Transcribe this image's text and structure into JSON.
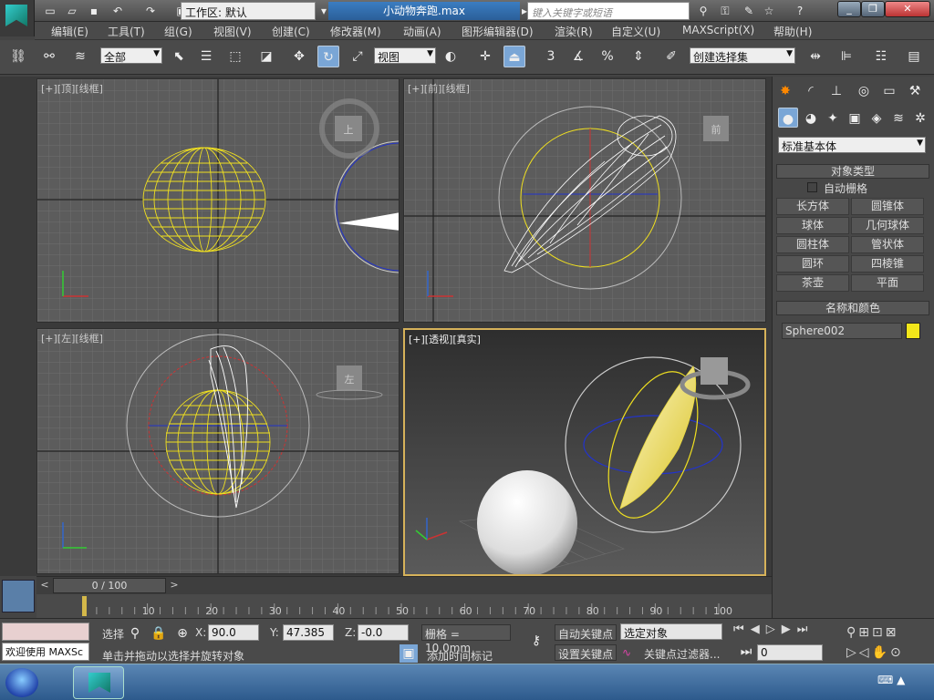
{
  "titlebar": {
    "workspace_label": "工作区: 默认",
    "doc_title": "小动物奔跑.max",
    "search_placeholder": "键入关键字或短语"
  },
  "menu": [
    "编辑(E)",
    "工具(T)",
    "组(G)",
    "视图(V)",
    "创建(C)",
    "修改器(M)",
    "动画(A)",
    "图形编辑器(D)",
    "渲染(R)",
    "自定义(U)",
    "MAXScript(X)",
    "帮助(H)"
  ],
  "toolbar": {
    "selection_filter": "全部",
    "ref_coord": "视图",
    "named_selection": "创建选择集",
    "snap_3": "3",
    "snap_pct": "%"
  },
  "viewports": {
    "top_label": "[+][顶][线框]",
    "front_label": "[+][前][线框]",
    "left_label": "[+][左][线框]",
    "persp_label": "[+][透视][真实]",
    "top_cube": "上",
    "front_cube": "前",
    "left_cube": "左"
  },
  "command_panel": {
    "category": "标准基本体",
    "object_type_title": "对象类型",
    "autogrid_label": "自动栅格",
    "buttons": [
      "长方体",
      "圆锥体",
      "球体",
      "几何球体",
      "圆柱体",
      "管状体",
      "圆环",
      "四棱锥",
      "茶壶",
      "平面"
    ],
    "name_color_title": "名称和颜色",
    "object_name": "Sphere002",
    "object_color": "#f2e61a"
  },
  "timeline": {
    "frame_readout": "0 / 100",
    "ticks": [
      "10",
      "20",
      "30",
      "40",
      "50",
      "60",
      "70",
      "80",
      "90",
      "100"
    ]
  },
  "status": {
    "maxscript_welcome": "欢迎使用 MAXSc",
    "selected_label": "选择",
    "x_label": "X:",
    "x_value": "90.0",
    "y_label": "Y:",
    "y_value": "47.385",
    "z_label": "Z:",
    "z_value": "-0.0",
    "grid_label": "栅格 = 10.0mm",
    "prompt": "单击并拖动以选择并旋转对象",
    "add_time_tag": "添加时间标记",
    "auto_key": "自动关键点",
    "set_key": "设置关键点",
    "key_mode_select": "选定对象",
    "key_filters": "关键点过滤器...",
    "current_frame": "0"
  }
}
